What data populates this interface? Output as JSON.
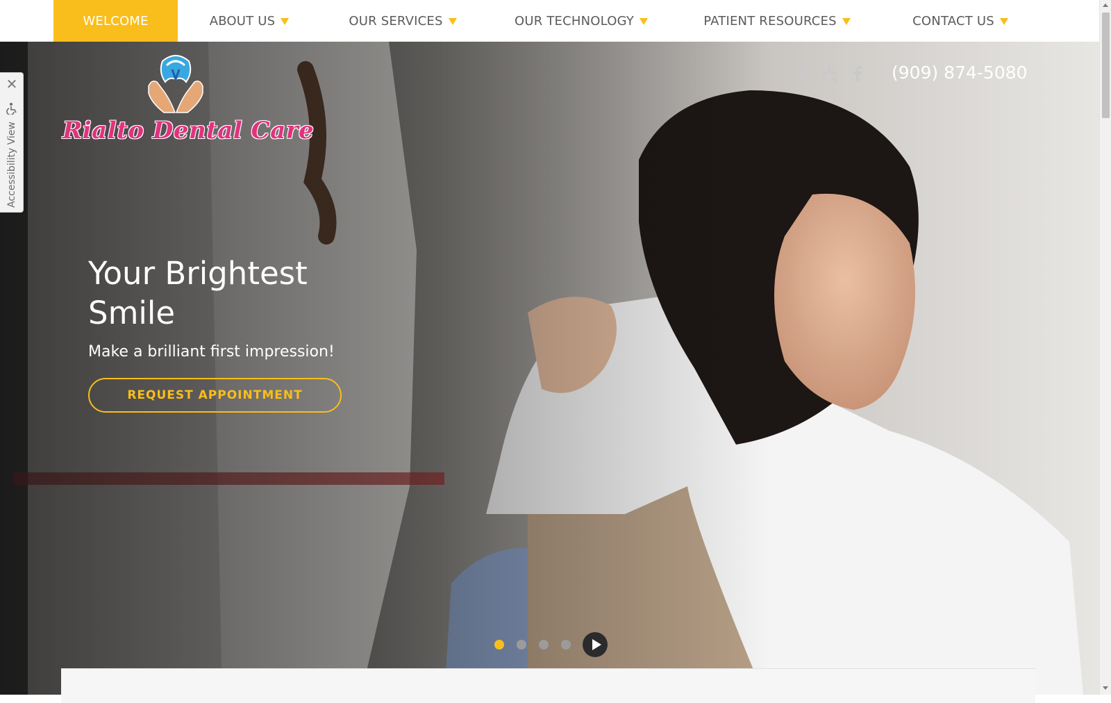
{
  "nav": {
    "items": [
      {
        "label": "WELCOME",
        "active": true,
        "has_caret": false
      },
      {
        "label": "ABOUT US",
        "active": false,
        "has_caret": true
      },
      {
        "label": "OUR SERVICES",
        "active": false,
        "has_caret": true
      },
      {
        "label": "OUR TECHNOLOGY",
        "active": false,
        "has_caret": true
      },
      {
        "label": "PATIENT RESOURCES",
        "active": false,
        "has_caret": true
      },
      {
        "label": "CONTACT US",
        "active": false,
        "has_caret": true
      }
    ]
  },
  "accessibility": {
    "label": "Accessibility View",
    "close_glyph": "✕"
  },
  "logo": {
    "text": "Rialto Dental Care"
  },
  "social": {
    "icons": [
      "google-icon",
      "yelp-icon",
      "facebook-icon"
    ]
  },
  "phone": "(909) 874-5080",
  "hero": {
    "title": "Your Brightest Smile",
    "subtitle": "Make a brilliant first impression!",
    "cta_label": "REQUEST APPOINTMENT"
  },
  "slider": {
    "slide_count": 4,
    "active_index": 0
  },
  "colors": {
    "accent": "#f9be1b",
    "brand_pink": "#e0337e",
    "nav_text": "#5b5b5b"
  }
}
